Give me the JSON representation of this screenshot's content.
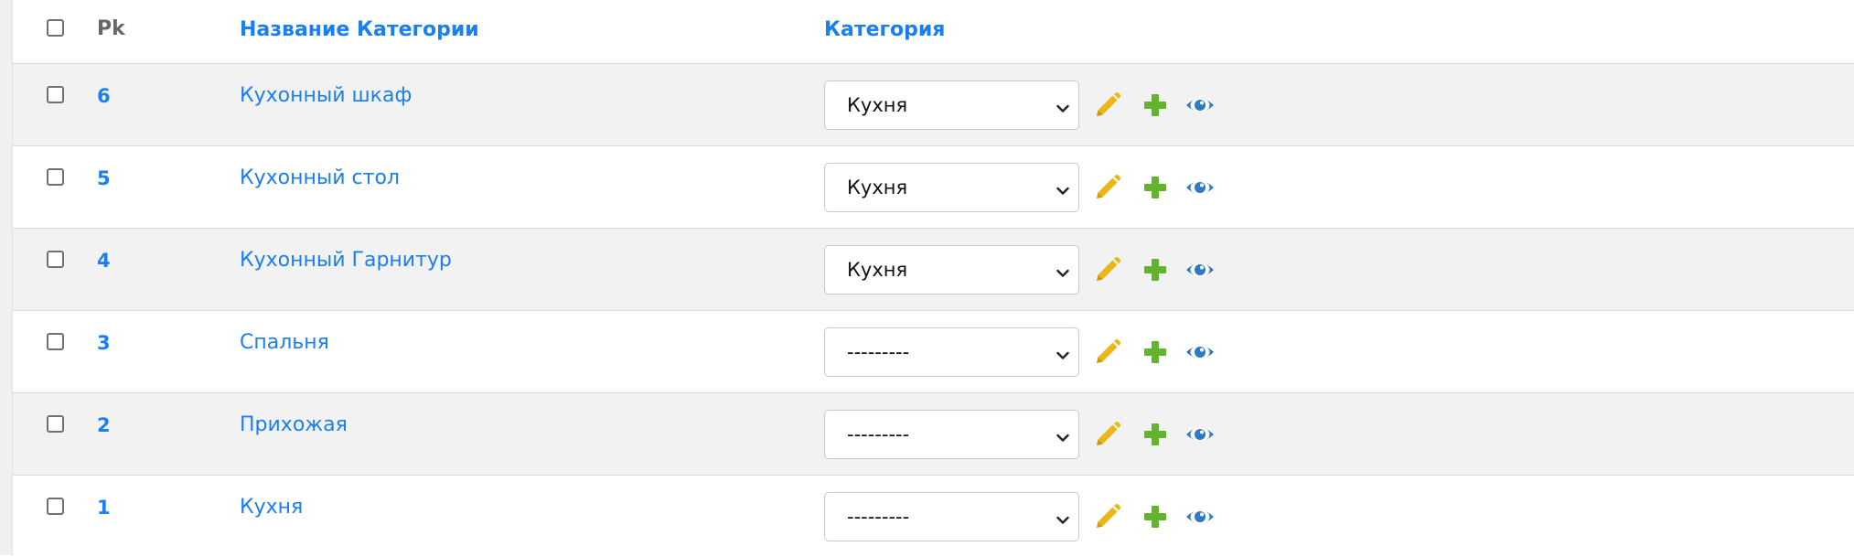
{
  "header": {
    "pk": "Pk",
    "name": "Название Категории",
    "category": "Категория"
  },
  "rows": [
    {
      "pk": "6",
      "name": "Кухонный шкаф",
      "category": "Кухня"
    },
    {
      "pk": "5",
      "name": "Кухонный стол",
      "category": "Кухня"
    },
    {
      "pk": "4",
      "name": "Кухонный Гарнитур",
      "category": "Кухня"
    },
    {
      "pk": "3",
      "name": "Спальня",
      "category": "---------"
    },
    {
      "pk": "2",
      "name": "Прихожая",
      "category": "---------"
    },
    {
      "pk": "1",
      "name": "Кухня",
      "category": "---------"
    }
  ],
  "icons": {
    "edit": "pencil-icon",
    "add": "plus-icon",
    "view": "eye-icon",
    "dropdown": "chevron-down-icon"
  },
  "colors": {
    "link": "#1a7ff0",
    "edit": "#e8b818",
    "add": "#62b32e",
    "view": "#2f78c4",
    "row_alt": "#f2f2f2"
  }
}
